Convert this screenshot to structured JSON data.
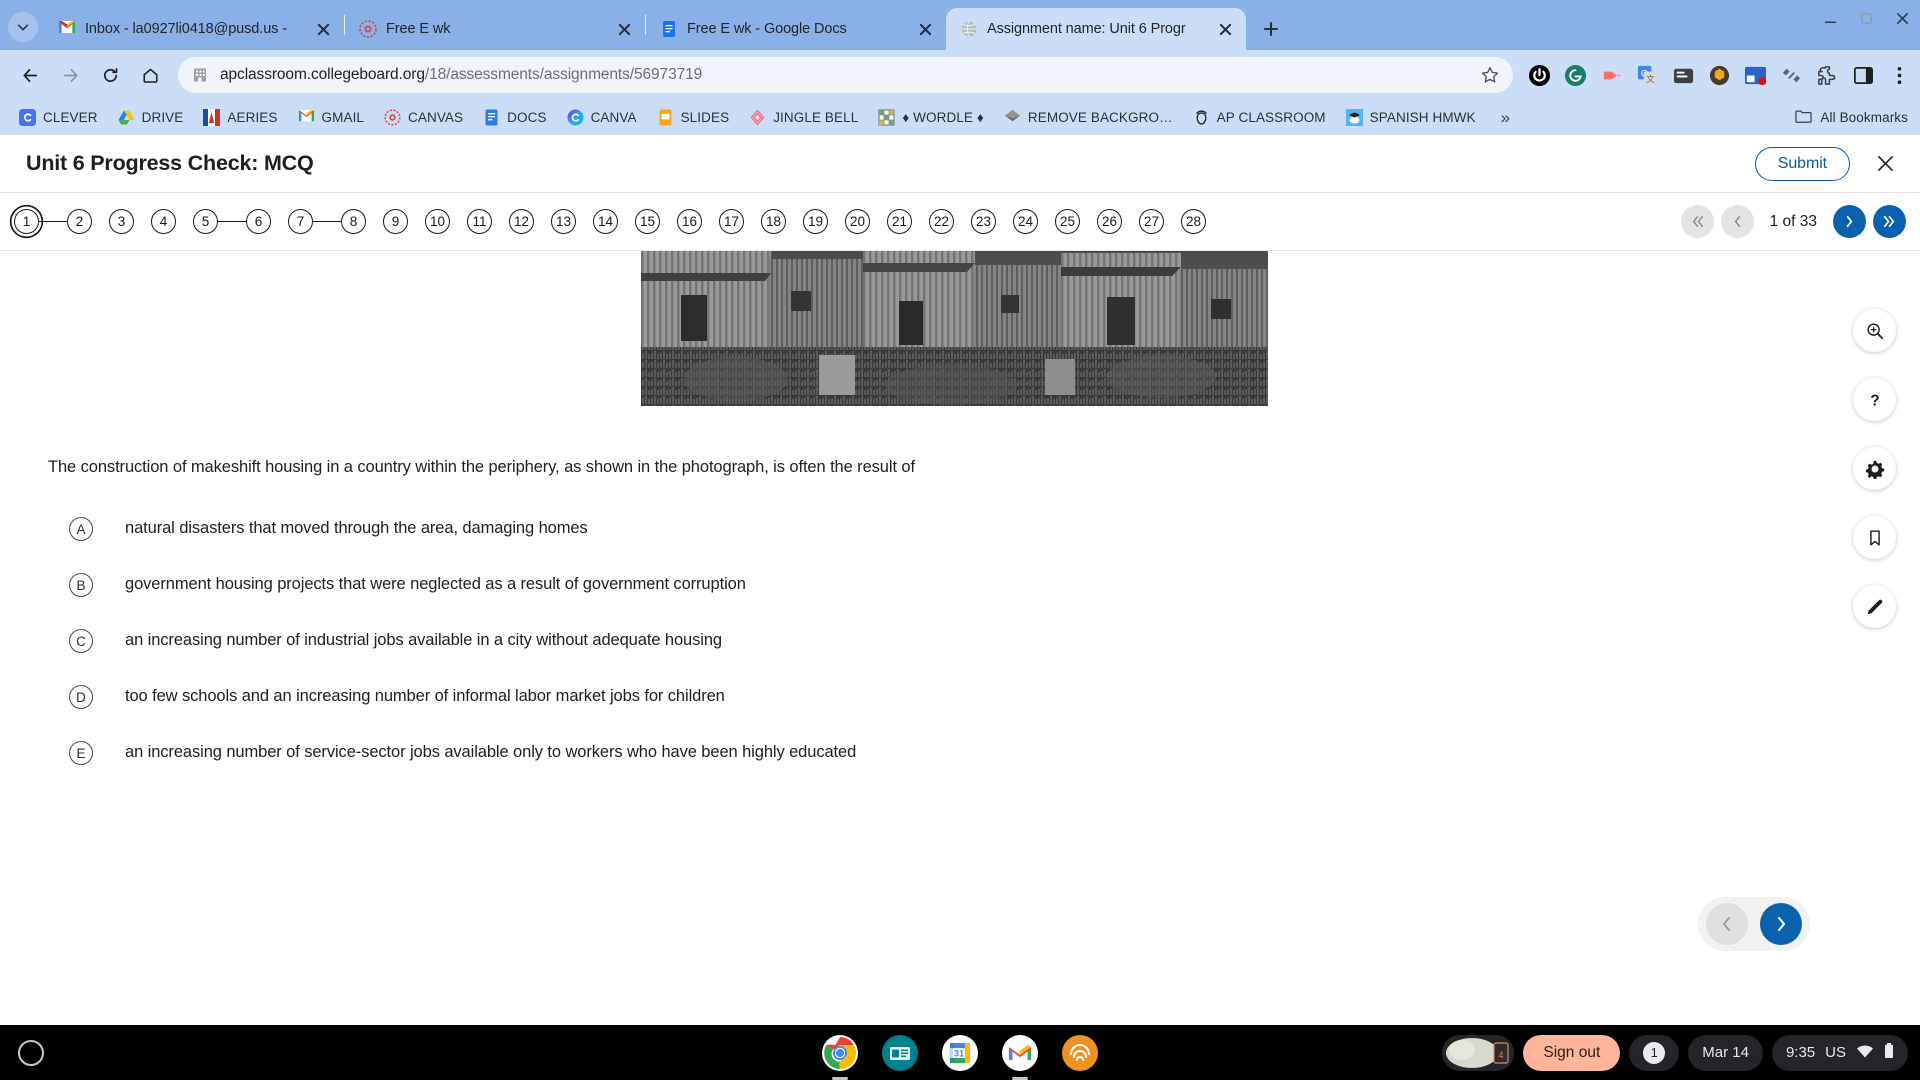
{
  "browser": {
    "tabs": [
      {
        "title": "Inbox - la0927li0418@pusd.us -",
        "icon": "gmail-icon",
        "active": false
      },
      {
        "title": "Free E wk",
        "icon": "canvas-icon",
        "active": false
      },
      {
        "title": "Free E wk - Google Docs",
        "icon": "google-docs-icon",
        "active": false
      },
      {
        "title": "Assignment name: Unit 6 Progr",
        "icon": "globe-icon",
        "active": true
      }
    ],
    "url_bold": "apclassroom.collegeboard.org",
    "url_grey": "/18/assessments/assignments/56973719",
    "extensions": [
      "power-icon",
      "grammarly-icon",
      "screencast-icon",
      "google-translate-icon",
      "screenshot-icon",
      "honey-icon",
      "recording-icon",
      "shortcut-icon",
      "puzzle-extension-icon",
      "side-panel-icon",
      "chrome-menu-icon"
    ],
    "bookmarks": [
      {
        "label": "CLEVER",
        "icon": "clever-icon"
      },
      {
        "label": "DRIVE",
        "icon": "google-drive-icon"
      },
      {
        "label": "AERIES",
        "icon": "aeries-icon"
      },
      {
        "label": "GMAIL",
        "icon": "gmail-icon"
      },
      {
        "label": "CANVAS",
        "icon": "canvas-icon"
      },
      {
        "label": "DOCS",
        "icon": "google-docs-icon"
      },
      {
        "label": "CANVA",
        "icon": "canva-icon"
      },
      {
        "label": "SLIDES",
        "icon": "google-slides-icon"
      },
      {
        "label": "JINGLE BELL",
        "icon": "jingle-bell-icon"
      },
      {
        "label": "♦ WORDLE ♦",
        "icon": "wordle-icon"
      },
      {
        "label": "REMOVE BACKGRO…",
        "icon": "remove-background-icon"
      },
      {
        "label": "AP CLASSROOM",
        "icon": "ap-classroom-acorn-icon"
      },
      {
        "label": "SPANISH HMWK",
        "icon": "spanish-homework-icon"
      }
    ],
    "bookmarks_overflow": "»",
    "all_bookmarks": "All Bookmarks"
  },
  "assessment": {
    "title": "Unit 6 Progress Check: MCQ",
    "submit_label": "Submit",
    "close_label": "✕",
    "nav_groups": [
      {
        "items": [
          "1",
          "2"
        ],
        "linked": true
      },
      {
        "items": [
          "3"
        ],
        "linked": false
      },
      {
        "items": [
          "4"
        ],
        "linked": false
      },
      {
        "items": [
          "5",
          "6"
        ],
        "linked": true
      },
      {
        "items": [
          "7",
          "8"
        ],
        "linked": true
      },
      {
        "items": [
          "9"
        ],
        "linked": false
      },
      {
        "items": [
          "10"
        ],
        "linked": false
      },
      {
        "items": [
          "11"
        ],
        "linked": false
      },
      {
        "items": [
          "12"
        ],
        "linked": false
      },
      {
        "items": [
          "13"
        ],
        "linked": false
      },
      {
        "items": [
          "14"
        ],
        "linked": false
      },
      {
        "items": [
          "15"
        ],
        "linked": false
      },
      {
        "items": [
          "16"
        ],
        "linked": false
      },
      {
        "items": [
          "17"
        ],
        "linked": false
      },
      {
        "items": [
          "18"
        ],
        "linked": false
      },
      {
        "items": [
          "19"
        ],
        "linked": false
      },
      {
        "items": [
          "20"
        ],
        "linked": false
      },
      {
        "items": [
          "21"
        ],
        "linked": false
      },
      {
        "items": [
          "22"
        ],
        "linked": false
      },
      {
        "items": [
          "23"
        ],
        "linked": false
      },
      {
        "items": [
          "24"
        ],
        "linked": false
      },
      {
        "items": [
          "25"
        ],
        "linked": false
      },
      {
        "items": [
          "26"
        ],
        "linked": false
      },
      {
        "items": [
          "27"
        ],
        "linked": false
      },
      {
        "items": [
          "28"
        ],
        "linked": false
      }
    ],
    "current_question": "1",
    "page_count": "1 of 33",
    "pager": {
      "first_label": "«",
      "prev_label": "‹",
      "next_label": "›",
      "last_label": "»"
    }
  },
  "question": {
    "stem": "The construction of makeshift housing in a country within the periphery, as shown in the photograph, is often the result of",
    "choices": [
      {
        "letter": "A",
        "text": "natural disasters that moved through the area, damaging homes"
      },
      {
        "letter": "B",
        "text": "government housing projects that were neglected as a result of government corruption"
      },
      {
        "letter": "C",
        "text": "an increasing number of industrial jobs available in a city without adequate housing"
      },
      {
        "letter": "D",
        "text": "too few schools and an increasing number of informal labor market jobs for children"
      },
      {
        "letter": "E",
        "text": "an increasing number of service-sector jobs available only to workers who have been highly educated"
      }
    ]
  },
  "rail_tools": [
    {
      "name": "zoom-in-icon",
      "label": "Zoom"
    },
    {
      "name": "help-icon",
      "label": "Help"
    },
    {
      "name": "settings-gear-icon",
      "label": "Settings"
    },
    {
      "name": "bookmark-icon",
      "label": "Bookmark"
    },
    {
      "name": "pencil-annotate-icon",
      "label": "Annotate"
    }
  ],
  "shelf": {
    "apps": [
      "chrome-icon",
      "news-icon",
      "google-calendar-icon",
      "gmail-icon",
      "audible-icon"
    ],
    "sign_out_label": "Sign out",
    "notification_count": "1",
    "date": "Mar 14",
    "time": "9:35",
    "locale": "US"
  },
  "colors": {
    "accent_blue": "#0a62ae",
    "tab_strip": "#8ab0e8",
    "toolbar": "#ccdef7",
    "sign_out": "#ffb59a"
  }
}
